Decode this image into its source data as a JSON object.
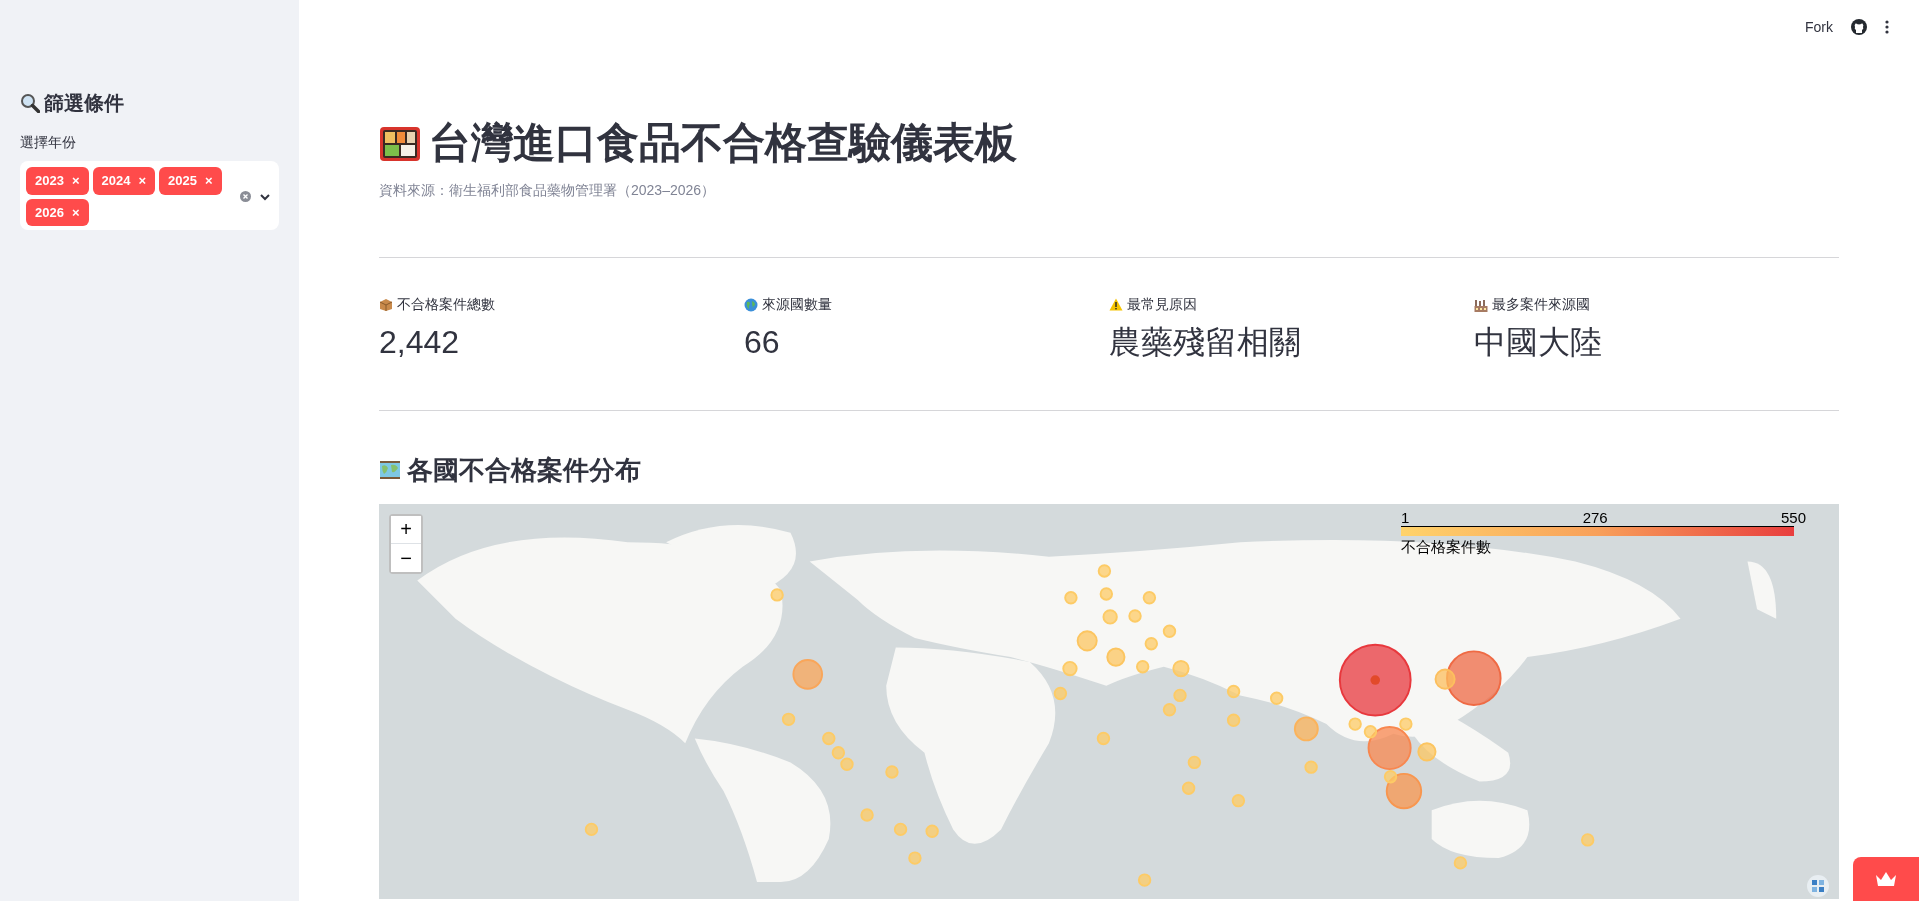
{
  "toolbar": {
    "fork": "Fork"
  },
  "sidebar": {
    "title": "篩選條件",
    "filter": {
      "label": "選擇年份",
      "tags": [
        {
          "label": "2023",
          "remove": "×"
        },
        {
          "label": "2024",
          "remove": "×"
        },
        {
          "label": "2025",
          "remove": "×"
        },
        {
          "label": "2026",
          "remove": "×"
        }
      ]
    }
  },
  "page": {
    "title": "台灣進口食品不合格查驗儀表板",
    "caption": "資料來源：衛生福利部食品藥物管理署（2023–2026）"
  },
  "metrics": [
    {
      "kind": "box",
      "label": "不合格案件總數",
      "value": "2,442"
    },
    {
      "kind": "globe",
      "label": "來源國數量",
      "value": "66"
    },
    {
      "kind": "warning",
      "label": "最常見原因",
      "value": "農藥殘留相關"
    },
    {
      "kind": "factory",
      "label": "最多案件來源國",
      "value": "中國大陸"
    }
  ],
  "map_section": {
    "title": "各國不合格案件分布",
    "zoom_in": "+",
    "zoom_out": "−",
    "legend": {
      "title": "不合格案件數",
      "ticks": [
        "1",
        "276",
        "550"
      ]
    }
  }
}
